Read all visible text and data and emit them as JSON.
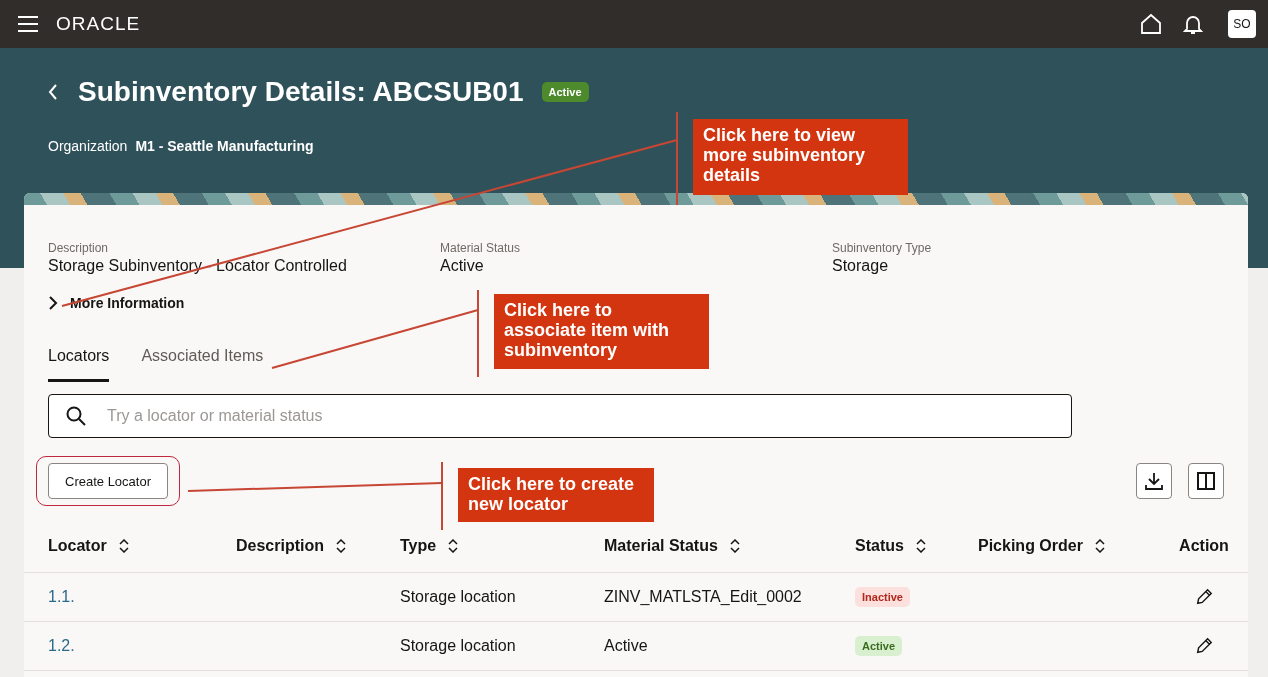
{
  "header": {
    "brand": "ORACLE",
    "avatar": "SO"
  },
  "page": {
    "title": "Subinventory Details: ABCSUB01",
    "status": {
      "label": "Active",
      "kind": "active"
    },
    "org_label": "Organization",
    "org_value": "M1 - Seattle Manufacturing"
  },
  "fields": [
    {
      "label": "Description",
      "value": "Storage Subinventory - Locator Controlled"
    },
    {
      "label": "Material Status",
      "value": "Active"
    },
    {
      "label": "Subinventory Type",
      "value": "Storage"
    }
  ],
  "more_information": {
    "label": "More Information",
    "expanded": false
  },
  "tabs": [
    {
      "label": "Locators",
      "selected": true
    },
    {
      "label": "Associated Items",
      "selected": false
    }
  ],
  "search": {
    "placeholder": "Try a locator or material status"
  },
  "create_button": {
    "label": "Create Locator",
    "highlighted": true
  },
  "table": {
    "columns": [
      {
        "label": "Locator",
        "sortable": true
      },
      {
        "label": "Description",
        "sortable": true
      },
      {
        "label": "Type",
        "sortable": true
      },
      {
        "label": "Material Status",
        "sortable": true
      },
      {
        "label": "Status",
        "sortable": true
      },
      {
        "label": "Picking Order",
        "sortable": true
      },
      {
        "label": "Action",
        "sortable": false
      }
    ],
    "rows": [
      {
        "locator": "1.1.",
        "description": "",
        "type": "Storage location",
        "material_status": "ZINV_MATLSTA_Edit_0002",
        "status": {
          "label": "Inactive",
          "kind": "inactive"
        }
      },
      {
        "locator": "1.2.",
        "description": "",
        "type": "Storage location",
        "material_status": "Active",
        "status": {
          "label": "Active",
          "kind": "active"
        }
      }
    ]
  },
  "annotations": [
    {
      "text": "Click here to view more subinventory details"
    },
    {
      "text": "Click here to associate item with subinventory"
    },
    {
      "text": "Click here to create new locator"
    }
  ]
}
